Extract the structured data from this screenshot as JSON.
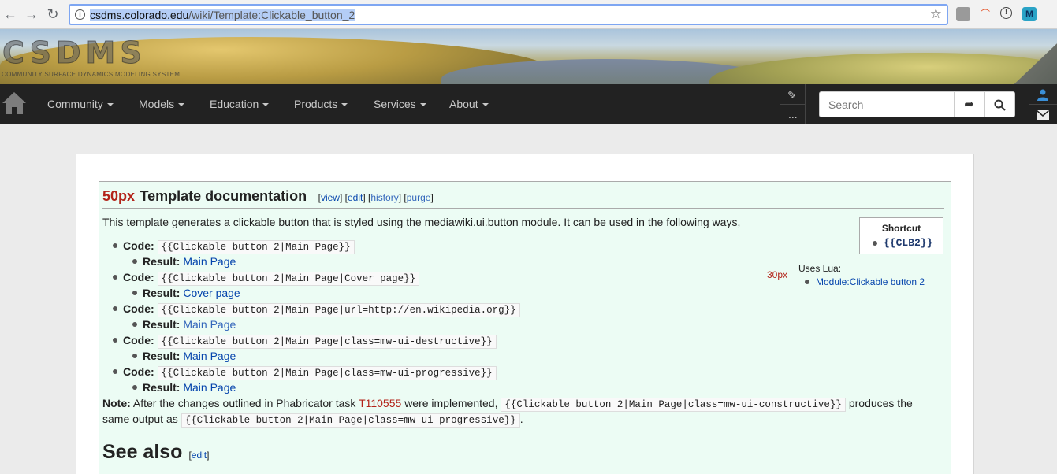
{
  "browser": {
    "url_host": "csdms.colorado.edu",
    "url_path": "/wiki/Template:Clickable_button_2"
  },
  "banner": {
    "logo": "CSDMS",
    "tagline": "COMMUNITY SURFACE DYNAMICS MODELING SYSTEM"
  },
  "nav": {
    "items": [
      "Community",
      "Models",
      "Education",
      "Products",
      "Services",
      "About"
    ],
    "edit_more": "...",
    "search_placeholder": "Search"
  },
  "doc": {
    "px_label": "50px",
    "title": "Template documentation",
    "view": "view",
    "edit": "edit",
    "history": "history",
    "purge": "purge",
    "intro": "This template generates a clickable button that is styled using the mediawiki.ui.button module. It can be used in the following ways,",
    "code_label": "Code:",
    "result_label": "Result:",
    "examples": [
      {
        "code": "{{Clickable button 2|Main Page}}",
        "result": "Main Page"
      },
      {
        "code": "{{Clickable button 2|Main Page|Cover page}}",
        "result": "Cover page"
      },
      {
        "code": "{{Clickable button 2|Main Page|url=http://en.wikipedia.org}}",
        "result": "Main Page"
      },
      {
        "code": "{{Clickable button 2|Main Page|class=mw-ui-destructive}}",
        "result": "Main Page"
      },
      {
        "code": "{{Clickable button 2|Main Page|class=mw-ui-progressive}}",
        "result": "Main Page"
      }
    ],
    "note_label": "Note:",
    "note_1": "After the changes outlined in Phabricator task",
    "note_task": "T110555",
    "note_2": "were implemented,",
    "note_code_1": "{{Clickable button 2|Main Page|class=mw-ui-constructive}}",
    "note_3": "produces the",
    "note_4": "same output as",
    "note_code_2": "{{Clickable button 2|Main Page|class=mw-ui-progressive}}",
    "note_end": ".",
    "shortcut_title": "Shortcut",
    "shortcut_code": "{{CLB2}}",
    "lua_px": "30px",
    "lua_label": "Uses Lua:",
    "lua_module": "Module:Clickable button 2"
  },
  "see_also": {
    "title": "See also",
    "edit": "edit"
  }
}
